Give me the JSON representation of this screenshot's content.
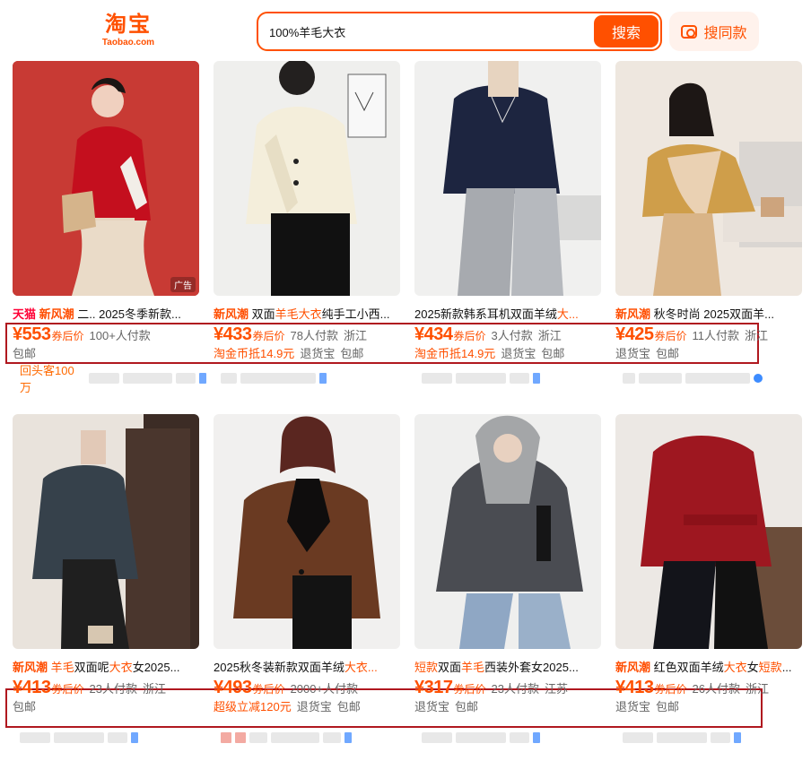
{
  "header": {
    "logo_cn": "淘宝",
    "logo_en": "Taobao.com",
    "search_value": "100%羊毛大衣",
    "search_button": "搜索",
    "same_style_button": "搜同款"
  },
  "ad_label": "广告",
  "products": [
    {
      "title_parts": [
        {
          "text": "天猫",
          "type": "tmall"
        },
        {
          "text": " 新风潮 ",
          "type": "tag"
        },
        {
          "text": "二.. 2025冬季新款...",
          "type": "normal"
        }
      ],
      "price": "¥553",
      "price_note": "券后价",
      "sold": "100+人付款",
      "location": "",
      "benefits": [
        {
          "text": "包邮",
          "type": "normal"
        }
      ],
      "shop_text": "回头客100万"
    },
    {
      "title_parts": [
        {
          "text": "新风潮",
          "type": "tag"
        },
        {
          "text": " 双面",
          "type": "normal"
        },
        {
          "text": "羊毛大衣",
          "type": "hl"
        },
        {
          "text": "纯手工小西...",
          "type": "normal"
        }
      ],
      "price": "¥433",
      "price_note": "券后价",
      "sold": "78人付款",
      "location": "浙江",
      "benefits": [
        {
          "text": "淘金币抵14.9元",
          "type": "orange"
        },
        {
          "text": "退货宝",
          "type": "normal"
        },
        {
          "text": "包邮",
          "type": "normal"
        }
      ],
      "shop_text": ""
    },
    {
      "title_parts": [
        {
          "text": "2025新款韩系耳机双面羊绒",
          "type": "normal"
        },
        {
          "text": "大...",
          "type": "hl"
        }
      ],
      "price": "¥434",
      "price_note": "券后价",
      "sold": "3人付款",
      "location": "浙江",
      "benefits": [
        {
          "text": "淘金币抵14.9元",
          "type": "orange"
        },
        {
          "text": "退货宝",
          "type": "normal"
        },
        {
          "text": "包邮",
          "type": "normal"
        }
      ],
      "shop_text": ""
    },
    {
      "title_parts": [
        {
          "text": "新风潮",
          "type": "tag"
        },
        {
          "text": " 秋冬时尚 2025双面羊...",
          "type": "normal"
        }
      ],
      "price": "¥425",
      "price_note": "券后价",
      "sold": "11人付款",
      "location": "浙江",
      "benefits": [
        {
          "text": "退货宝",
          "type": "normal"
        },
        {
          "text": "包邮",
          "type": "normal"
        }
      ],
      "shop_text": ""
    },
    {
      "title_parts": [
        {
          "text": "新风潮",
          "type": "tag"
        },
        {
          "text": " ",
          "type": "normal"
        },
        {
          "text": "羊毛",
          "type": "hl"
        },
        {
          "text": "双面呢",
          "type": "normal"
        },
        {
          "text": "大衣",
          "type": "hl"
        },
        {
          "text": "女2025...",
          "type": "normal"
        }
      ],
      "price": "¥413",
      "price_note": "券后价",
      "sold": "23人付款",
      "location": "浙江",
      "benefits": [
        {
          "text": "包邮",
          "type": "normal"
        }
      ],
      "shop_text": ""
    },
    {
      "title_parts": [
        {
          "text": "2025秋冬装新款双面羊绒",
          "type": "normal"
        },
        {
          "text": "大衣...",
          "type": "hl"
        }
      ],
      "price": "¥493",
      "price_note": "券后价",
      "sold": "2000+人付款",
      "location": "",
      "benefits": [
        {
          "text": "超级立减120元",
          "type": "orange"
        },
        {
          "text": "退货宝",
          "type": "normal"
        },
        {
          "text": "包邮",
          "type": "normal"
        }
      ],
      "shop_text": ""
    },
    {
      "title_parts": [
        {
          "text": "短款",
          "type": "hl"
        },
        {
          "text": "双面",
          "type": "normal"
        },
        {
          "text": "羊毛",
          "type": "hl"
        },
        {
          "text": "西装外套女2025...",
          "type": "normal"
        }
      ],
      "price": "¥317",
      "price_note": "券后价",
      "sold": "23人付款",
      "location": "江苏",
      "benefits": [
        {
          "text": "退货宝",
          "type": "normal"
        },
        {
          "text": "包邮",
          "type": "normal"
        }
      ],
      "shop_text": ""
    },
    {
      "title_parts": [
        {
          "text": "新风潮",
          "type": "tag"
        },
        {
          "text": " 红色双面羊绒",
          "type": "normal"
        },
        {
          "text": "大衣",
          "type": "hl"
        },
        {
          "text": "女",
          "type": "normal"
        },
        {
          "text": "短款",
          "type": "hl"
        },
        {
          "text": "...",
          "type": "normal"
        }
      ],
      "price": "¥413",
      "price_note": "券后价",
      "sold": "26人付款",
      "location": "浙江",
      "benefits": [
        {
          "text": "退货宝",
          "type": "normal"
        },
        {
          "text": "包邮",
          "type": "normal"
        }
      ],
      "shop_text": ""
    }
  ],
  "colors": {
    "accent": "#ff5000",
    "highlight_box": "#b0181f"
  }
}
